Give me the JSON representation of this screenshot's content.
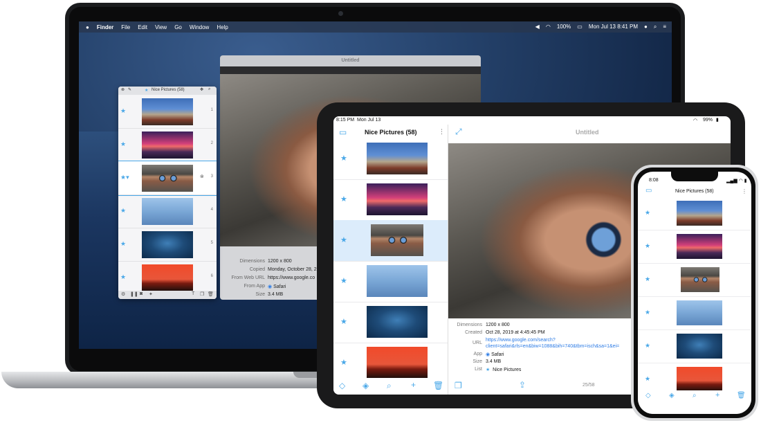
{
  "mac": {
    "menubar": {
      "apple": "",
      "items": [
        "Finder",
        "File",
        "Edit",
        "View",
        "Go",
        "Window",
        "Help"
      ],
      "battery": "100%",
      "clock": "Mon Jul 13  8:41 PM"
    },
    "preview": {
      "title": "Untitled",
      "meta": [
        {
          "k": "Dimensions",
          "v": "1200 x 800"
        },
        {
          "k": "Copied",
          "v": "Monday, October 28, 2"
        },
        {
          "k": "From Web URL",
          "v": "https://www.google.co"
        },
        {
          "k": "From App",
          "v": "Safari"
        },
        {
          "k": "Size",
          "v": "3.4 MB"
        }
      ]
    },
    "list": {
      "title": "Nice Pictures (58)",
      "items": [
        {
          "num": "1"
        },
        {
          "num": "2"
        },
        {
          "num": "3"
        },
        {
          "num": "4"
        },
        {
          "num": "5"
        },
        {
          "num": "6"
        }
      ]
    }
  },
  "ipad": {
    "status": {
      "time": "8:15 PM",
      "date": "Mon Jul 13",
      "battery": "99%"
    },
    "list_title": "Nice Pictures (58)",
    "detail_title": "Untitled",
    "meta": {
      "dimensions_k": "Dimensions",
      "dimensions_v": "1200 x 800",
      "created_k": "Created",
      "created_v": "Oct 28, 2019 at 4:45:45 PM",
      "url_k": "URL",
      "url_v1": "https://www.google.com/search?",
      "url_v2": "client=safari&rls=en&biw=1088&bih=740&tbm=isch&sa=1&ei=",
      "app_k": "App",
      "app_v": "Safari",
      "size_k": "Size",
      "size_v": "3.4 MB",
      "list_k": "List",
      "list_v": "Nice Pictures"
    },
    "page_counter": "25/58"
  },
  "iphone": {
    "time": "8:08",
    "list_title": "Nice Pictures (58)"
  },
  "colors": {
    "accent": "#4aa8e8",
    "link": "#2c7be5"
  }
}
